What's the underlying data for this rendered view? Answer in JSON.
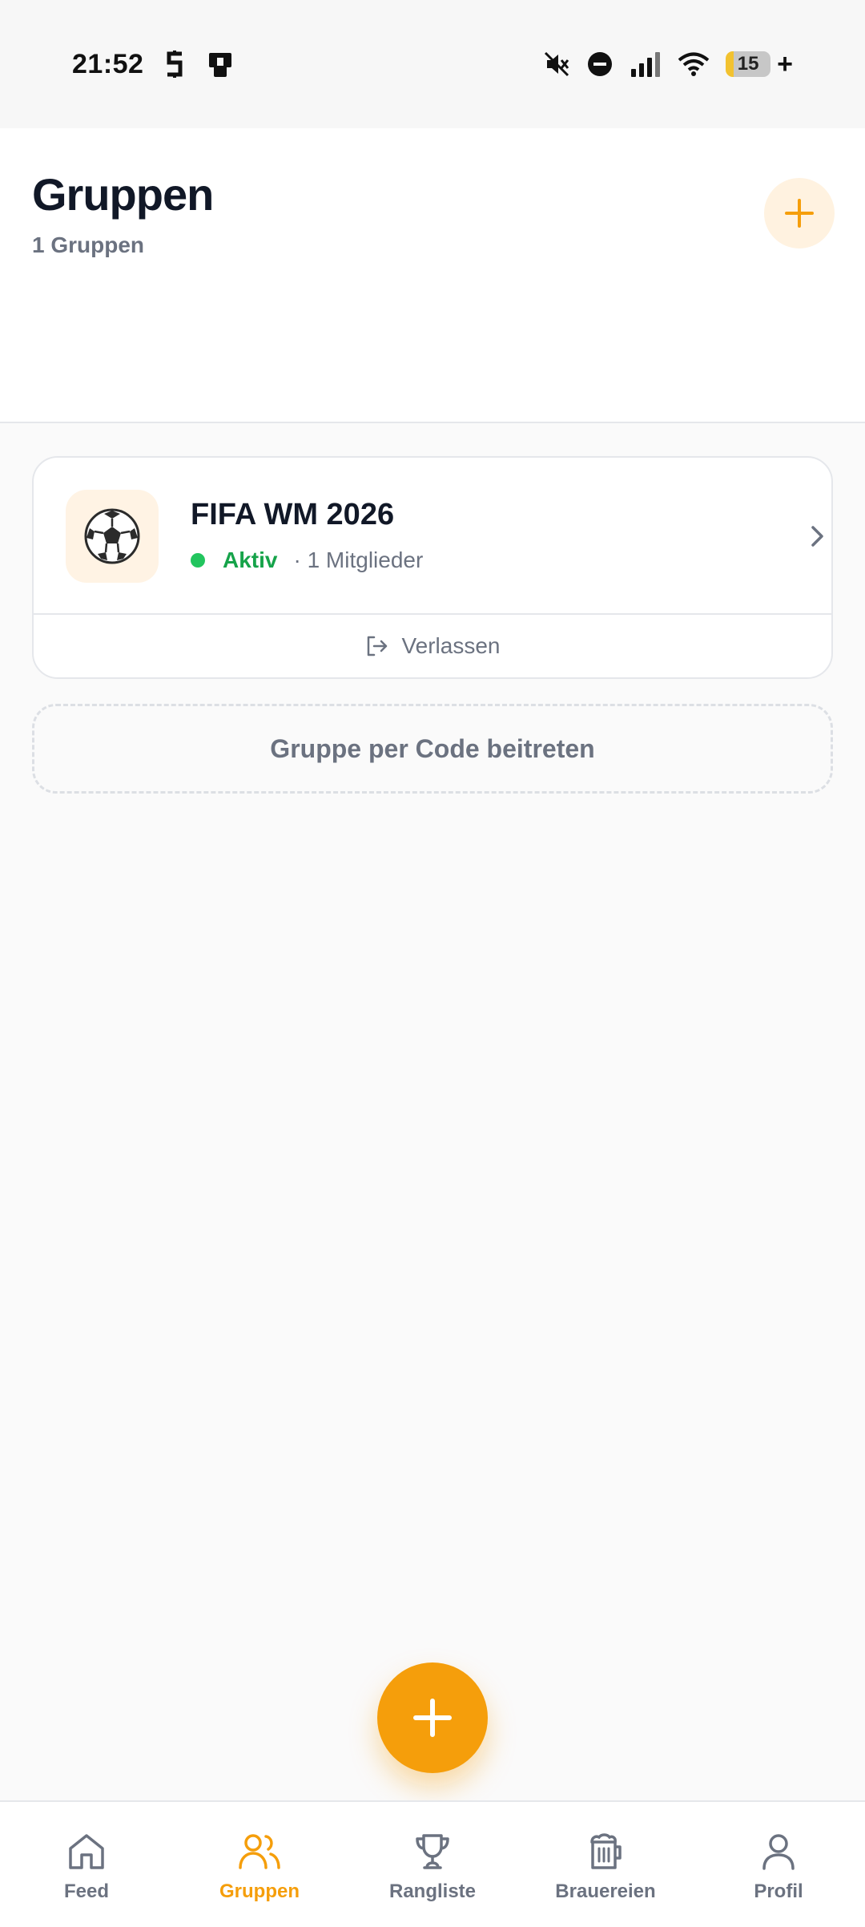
{
  "status_bar": {
    "time": "21:52",
    "battery_level": "15",
    "battery_plus": "+",
    "icons": [
      "s-app-icon",
      "cast-icon",
      "mute-icon",
      "dnd-icon",
      "signal-icon",
      "wifi-icon",
      "battery-icon"
    ]
  },
  "header": {
    "title": "Gruppen",
    "subtitle": "1 Gruppen",
    "add_icon": "plus-icon"
  },
  "groups": [
    {
      "name": "FIFA WM 2026",
      "avatar_emoji": "⚽",
      "status": "Aktiv",
      "members": "· 1 Mitglieder",
      "leave_label": "Verlassen"
    }
  ],
  "join": {
    "label": "Gruppe per Code beitreten"
  },
  "fab": {
    "icon": "plus-icon"
  },
  "nav": {
    "active": "gruppen",
    "items": [
      {
        "label": "Feed",
        "icon": "home-icon"
      },
      {
        "label": "Gruppen",
        "icon": "users-icon"
      },
      {
        "label": "Rangliste",
        "icon": "trophy-icon"
      },
      {
        "label": "Brauereien",
        "icon": "beer-mug-icon"
      },
      {
        "label": "Profil",
        "icon": "user-icon"
      }
    ]
  },
  "colors": {
    "accent": "#f59e0b",
    "accent_soft": "#fff2e0",
    "active_green": "#16a34a",
    "text_primary": "#111827",
    "text_muted": "#6b7280",
    "border": "#e5e7eb",
    "background": "#fafafa"
  }
}
